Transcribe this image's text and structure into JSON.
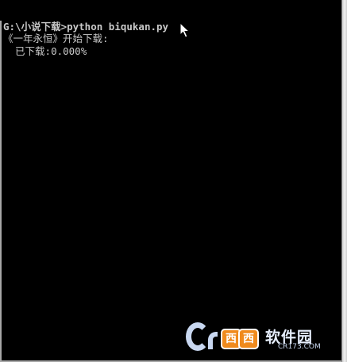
{
  "console": {
    "prompt": "G:\\小说下载>",
    "command": "python biqukan.py",
    "line2": "《一年永恒》开始下载:",
    "line3": "  已下载:0.000%"
  },
  "watermark": {
    "badge1": "西",
    "badge2": "西",
    "name": "软件园",
    "url": "CR173.COM"
  },
  "colors": {
    "background": "#000000",
    "text": "#c8c8c8",
    "watermark_accent": "#f08a1c"
  },
  "icons": [
    "mouse-cursor-icon",
    "cr173-logo"
  ]
}
